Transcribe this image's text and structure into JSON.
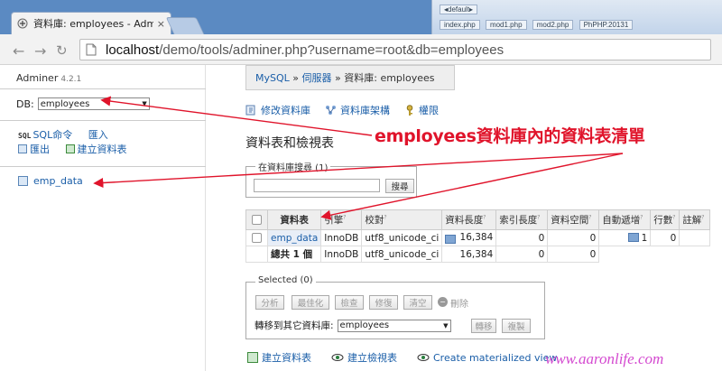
{
  "browser": {
    "tab_title": "資料庫: employees - Adm",
    "tab_close": "×",
    "url_scheme": "",
    "url_host": "localhost",
    "url_path": "/demo/tools/adminer.php?username=root&db=employees",
    "taskbar_row1": [
      "◂default▸"
    ],
    "taskbar_row2": [
      "index.php",
      "mod1.php",
      "mod2.php",
      "PhPHP.20131"
    ]
  },
  "sidebar": {
    "brand": "Adminer",
    "version": "4.2.1",
    "db_label": "DB:",
    "db_selected": "employees",
    "sql_tag": "SQL",
    "sql_command": "SQL命令",
    "import": "匯入",
    "export": "匯出",
    "create_table": "建立資料表",
    "tables": [
      "emp_data"
    ]
  },
  "main": {
    "breadcrumb": {
      "mysql": "MySQL",
      "sep": "»",
      "server": "伺服器",
      "current": "資料庫: employees"
    },
    "actions": [
      "修改資料庫",
      "資料庫架構",
      "權限"
    ],
    "heading": "資料表和檢視表",
    "search": {
      "legend": "在資料庫搜尋 (1)",
      "button": "搜尋"
    },
    "table": {
      "headers": [
        "資料表",
        "引擎",
        "校對",
        "資料長度",
        "索引長度",
        "資料空間",
        "自動遞增",
        "行數",
        "註解"
      ],
      "row": {
        "name": "emp_data",
        "engine": "InnoDB",
        "collation": "utf8_unicode_ci",
        "data_length": "16,384",
        "index_length": "0",
        "data_free": "0",
        "auto_increment": "1",
        "rows": "0",
        "comment": ""
      },
      "total": {
        "label": "總共 1 個",
        "engine": "InnoDB",
        "collation": "utf8_unicode_ci",
        "data_length": "16,384",
        "index_length": "0",
        "data_free": "0"
      }
    },
    "selected": {
      "legend": "Selected (0)",
      "buttons": [
        "分析",
        "最佳化",
        "檢查",
        "修復",
        "清空"
      ],
      "drop": "刪除",
      "move_label": "轉移到其它資料庫:",
      "move_db": "employees",
      "move_button": "轉移",
      "copy_button": "複製"
    },
    "bottom": [
      "建立資料表",
      "建立檢視表",
      "Create materialized view"
    ]
  },
  "annotation": {
    "callout": "employees資料庫內的資料表清單",
    "watermark": "www.aaronlife.com",
    "color": "#e0142b"
  }
}
